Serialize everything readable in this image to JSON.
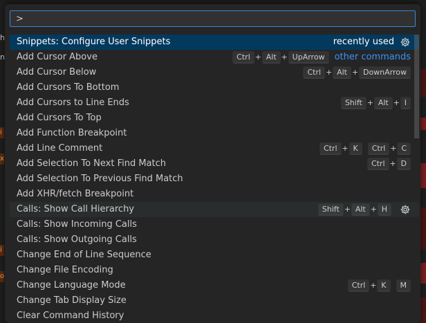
{
  "background": {
    "left_fragments": [
      "h.",
      "ng"
    ],
    "left_marks": [
      "i",
      "x",
      "i",
      "o"
    ]
  },
  "search": {
    "value": ">"
  },
  "rows": [
    {
      "label": "Snippets: Configure User Snippets",
      "tag": "recently used",
      "tag_kind": "recent",
      "gear": true,
      "state": "selected",
      "keys": []
    },
    {
      "label": "Add Cursor Above",
      "keys": [
        [
          "Ctrl",
          "Alt",
          "UpArrow"
        ]
      ],
      "tag": "other commands",
      "tag_kind": "other"
    },
    {
      "label": "Add Cursor Below",
      "keys": [
        [
          "Ctrl",
          "Alt",
          "DownArrow"
        ]
      ]
    },
    {
      "label": "Add Cursors To Bottom",
      "keys": []
    },
    {
      "label": "Add Cursors to Line Ends",
      "keys": [
        [
          "Shift",
          "Alt",
          "I"
        ]
      ]
    },
    {
      "label": "Add Cursors To Top",
      "keys": []
    },
    {
      "label": "Add Function Breakpoint",
      "keys": []
    },
    {
      "label": "Add Line Comment",
      "keys": [
        [
          "Ctrl",
          "K"
        ],
        [
          "Ctrl",
          "C"
        ]
      ]
    },
    {
      "label": "Add Selection To Next Find Match",
      "keys": [
        [
          "Ctrl",
          "D"
        ]
      ]
    },
    {
      "label": "Add Selection To Previous Find Match",
      "keys": []
    },
    {
      "label": "Add XHR/fetch Breakpoint",
      "keys": []
    },
    {
      "label": "Calls: Show Call Hierarchy",
      "keys": [
        [
          "Shift",
          "Alt",
          "H"
        ]
      ],
      "gear": true,
      "state": "hovered"
    },
    {
      "label": "Calls: Show Incoming Calls",
      "keys": []
    },
    {
      "label": "Calls: Show Outgoing Calls",
      "keys": []
    },
    {
      "label": "Change End of Line Sequence",
      "keys": []
    },
    {
      "label": "Change File Encoding",
      "keys": []
    },
    {
      "label": "Change Language Mode",
      "keys": [
        [
          "Ctrl",
          "K"
        ],
        [
          "M"
        ]
      ]
    },
    {
      "label": "Change Tab Display Size",
      "keys": []
    },
    {
      "label": "Clear Command History",
      "keys": []
    }
  ],
  "colors": {
    "selected_bg": "#04395e",
    "hover_bg": "#2a2d2e",
    "focus_border": "#3a86d4",
    "link": "#3794ff"
  },
  "icons": {
    "gear": "gear-icon"
  }
}
